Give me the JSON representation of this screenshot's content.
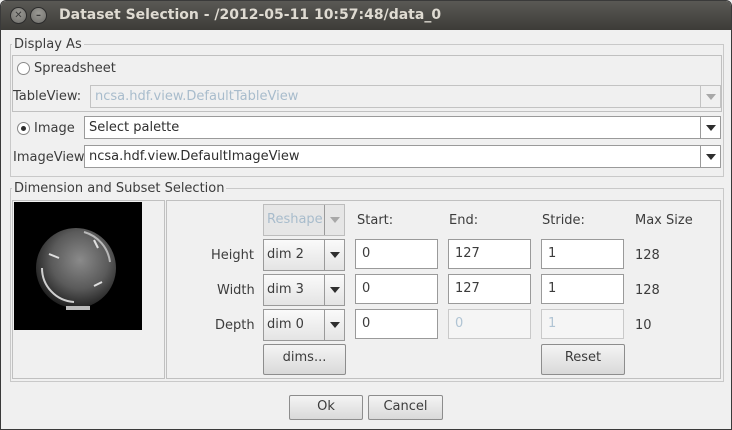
{
  "window": {
    "title": "Dataset Selection - /2012-05-11 10:57:48/data_0"
  },
  "display_as": {
    "legend": "Display As",
    "spreadsheet_label": "Spreadsheet",
    "tableview_label": "TableView:",
    "tableview_value": "ncsa.hdf.view.DefaultTableView",
    "image_label": "Image",
    "palette_value": "Select palette",
    "imageview_label": "ImageView:",
    "imageview_value": "ncsa.hdf.view.DefaultImageView",
    "selected": "Image"
  },
  "dimension": {
    "legend": "Dimension and Subset Selection",
    "reshape_label": "Reshape",
    "headers": {
      "start": "Start:",
      "end": "End:",
      "stride": "Stride:",
      "max": "Max Size"
    },
    "rows": [
      {
        "label": "Height",
        "dim": "dim 2",
        "start": "0",
        "end": "127",
        "stride": "1",
        "max": "128"
      },
      {
        "label": "Width",
        "dim": "dim 3",
        "start": "0",
        "end": "127",
        "stride": "1",
        "max": "128"
      },
      {
        "label": "Depth",
        "dim": "dim 0",
        "start": "0",
        "end": "0",
        "stride": "1",
        "max": "10"
      }
    ],
    "dims_button": "dims...",
    "reset_button": "Reset"
  },
  "footer": {
    "ok_label": "Ok",
    "cancel_label": "Cancel"
  }
}
